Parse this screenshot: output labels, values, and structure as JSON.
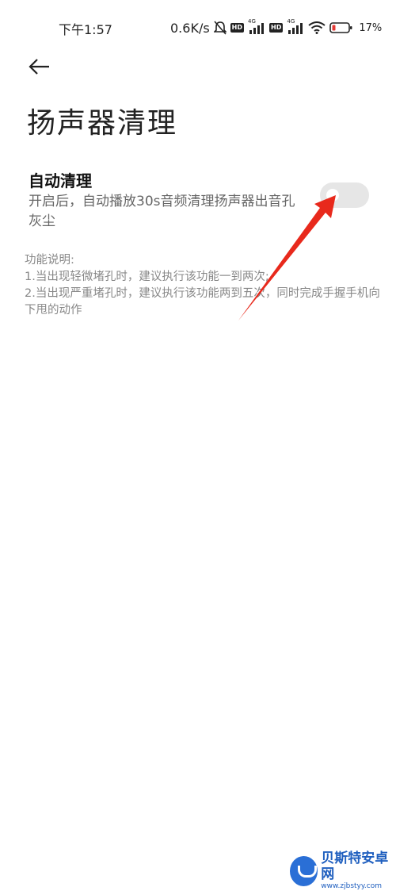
{
  "status_bar": {
    "time": "下午1:57",
    "speed": "0.6K/s",
    "hd1": "HD",
    "hd2": "HD",
    "net1": "4G",
    "net2": "4G",
    "battery": "17%",
    "icons": [
      "mute-icon",
      "signal-icon",
      "wifi-icon",
      "battery-icon"
    ],
    "battery_color": "#e53935"
  },
  "header": {
    "back_icon": "back-arrow-icon",
    "title": "扬声器清理"
  },
  "setting": {
    "title": "自动清理",
    "description": "开启后，自动播放30s音频清理扬声器出音孔灰尘",
    "toggle_on": false
  },
  "notes": {
    "heading": "功能说明:",
    "line1": "1.当出现轻微堵孔时，建议执行该功能一到两次;",
    "line2": "2.当出现严重堵孔时，建议执行该功能两到五次，同时完成手握手机向下甩的动作"
  },
  "annotation": {
    "arrow_color": "#e8291c"
  },
  "watermark": {
    "name": "贝斯特安卓网",
    "url": "www.zjbstyy.com"
  }
}
